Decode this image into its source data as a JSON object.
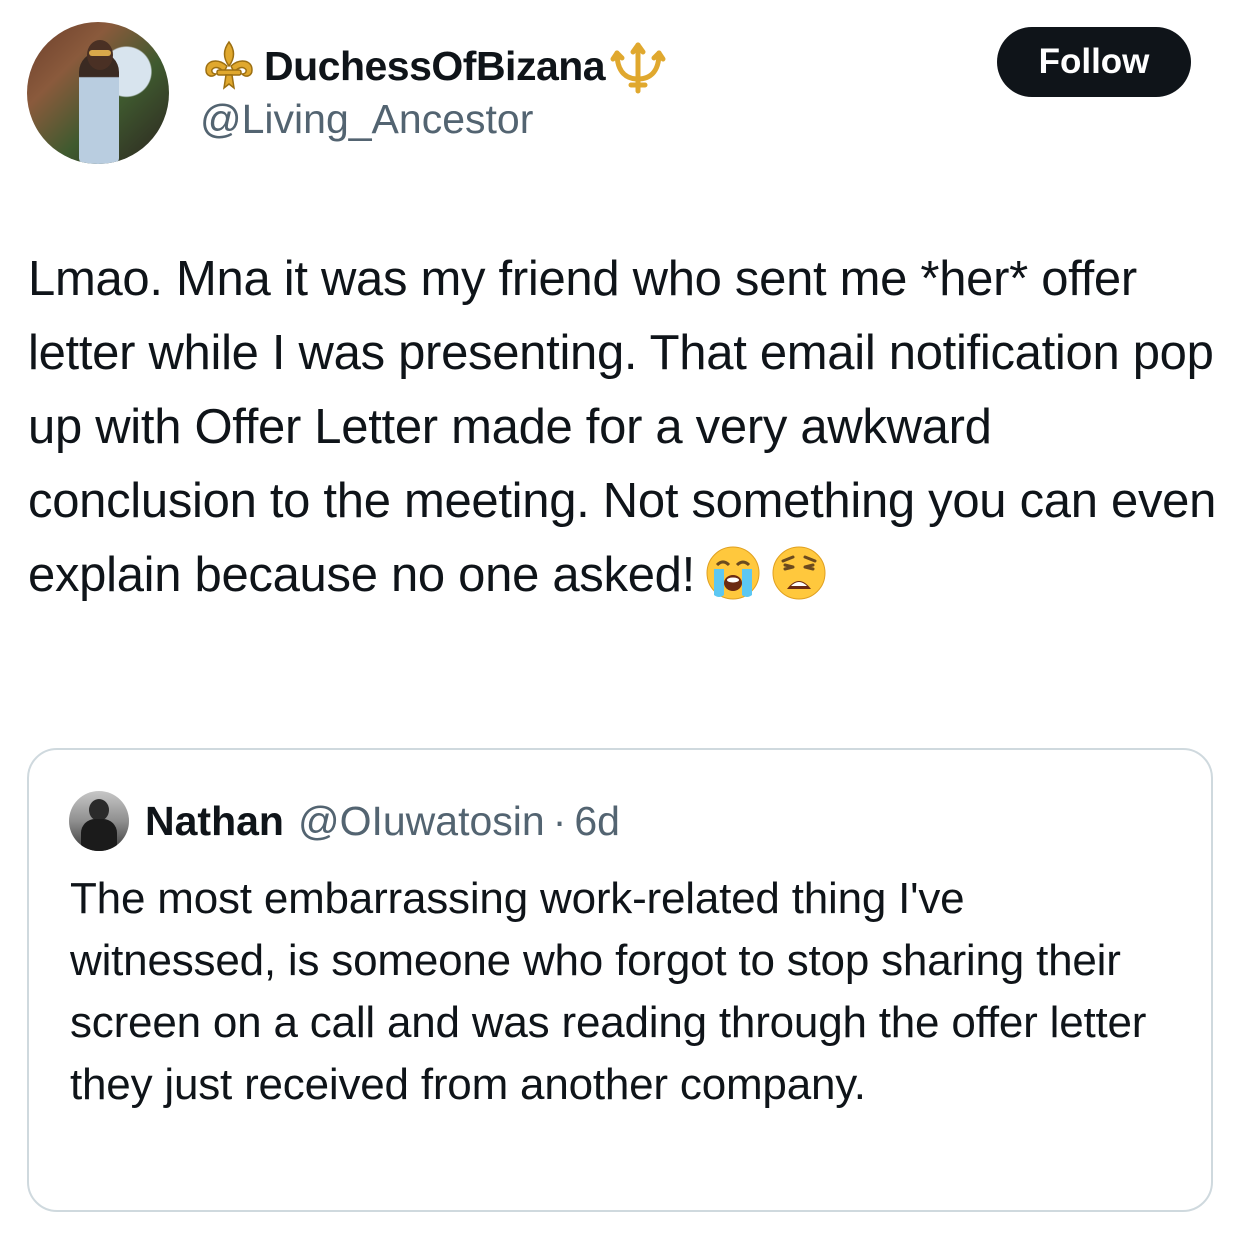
{
  "author": {
    "display_name": "DuchessOfBizana",
    "handle": "@Living_Ancestor",
    "name_prefix_icon": "fleur-de-lis-icon",
    "name_suffix_icon": "trident-icon",
    "follow_label": "Follow"
  },
  "tweet": {
    "text": "Lmao. Mna it was my friend who sent me *her* offer letter while I was presenting. That email notification pop up with Offer Letter made for a very awkward conclusion to the meeting. Not something you can even explain because no one asked!",
    "emojis": [
      "loudly-crying-face-emoji",
      "weary-face-emoji"
    ]
  },
  "quoted_tweet": {
    "name": "Nathan",
    "handle": "@OIuwatosin",
    "separator": "·",
    "time": "6d",
    "text": "The most embarrassing work-related thing I've witnessed, is someone who forgot to stop sharing their screen on a call and was reading through the offer letter they just received from another company."
  },
  "colors": {
    "text_primary": "#0f1419",
    "text_secondary": "#536471",
    "border": "#cfd9de",
    "button_bg": "#0f1419",
    "button_text": "#ffffff",
    "gold": "#e0a82e"
  }
}
